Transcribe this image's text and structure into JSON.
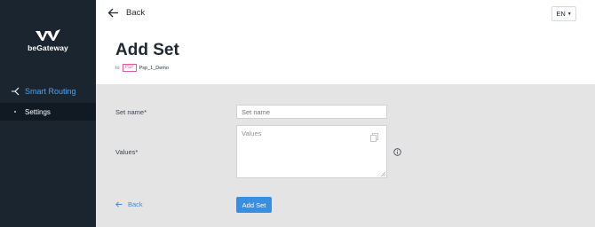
{
  "sidebar": {
    "logo_text": "beGateway",
    "section_label": "Smart Routing",
    "sub_item_label": "Settings"
  },
  "header": {
    "back_label": "Back",
    "language": "EN",
    "title": "Add Set",
    "subtitle_prefix": "to",
    "badge_label": "PSP",
    "psp_name": "Psp_1_Demo"
  },
  "form": {
    "set_name_label": "Set name*",
    "set_name_placeholder": "Set name",
    "values_label": "Values*",
    "values_placeholder": "Values",
    "back_label": "Back",
    "submit_label": "Add Set"
  },
  "colors": {
    "sidebar_bg": "#1b2530",
    "accent": "#3a8ee0",
    "badge": "#e05aa5"
  }
}
